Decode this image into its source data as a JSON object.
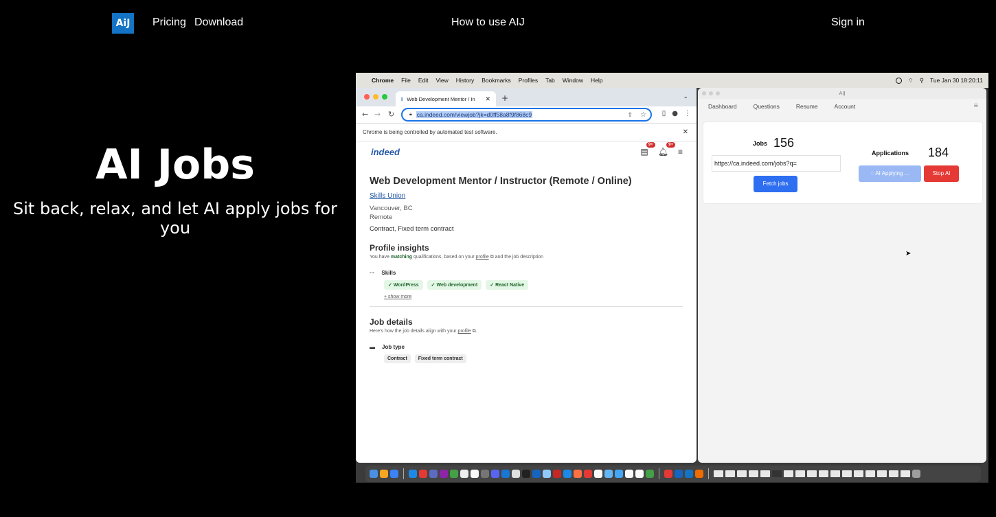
{
  "nav": {
    "logo": "AiJ",
    "pricing": "Pricing",
    "download": "Download",
    "how_to": "How to use AIJ",
    "sign_in": "Sign in"
  },
  "hero": {
    "title": "AI Jobs",
    "subtitle": "Sit back, relax, and let AI apply jobs for you"
  },
  "screenshot": {
    "mac_menu": {
      "app": "Chrome",
      "items": [
        "File",
        "Edit",
        "View",
        "History",
        "Bookmarks",
        "Profiles",
        "Tab",
        "Window",
        "Help"
      ],
      "clock": "Tue Jan 30  18:20:11"
    },
    "browser": {
      "tab_title": "Web Development Mentor / In",
      "url": "ca.indeed.com/viewjob?jk=d0ff58a8f9f868c9",
      "infobar": "Chrome is being controlled by automated test software.",
      "notification_badge": "9+"
    },
    "indeed": {
      "logo": "indeed",
      "job_title": "Web Development Mentor / Instructor (Remote / Online)",
      "company": "Skills Union",
      "location": "Vancouver, BC",
      "remote": "Remote",
      "contract": "Contract, Fixed term contract",
      "profile_insights_title": "Profile insights",
      "profile_insights_pre": "You have ",
      "profile_insights_match": "matching",
      "profile_insights_mid": " qualifications, based on your ",
      "profile_link": "profile",
      "profile_insights_post": " and the job description",
      "skills_label": "Skills",
      "skills": [
        "WordPress",
        "Web development",
        "React Native"
      ],
      "show_more": "+ show more",
      "job_details_title": "Job details",
      "job_details_pre": "Here's how the job details align with your ",
      "job_details_post": ".",
      "job_type_label": "Job type",
      "job_types": [
        "Contract",
        "Fixed term contract"
      ]
    },
    "aij_app": {
      "window_title": "AIJ",
      "nav": [
        "Dashboard",
        "Questions",
        "Resume",
        "Account"
      ],
      "jobs_label": "Jobs",
      "jobs_count": "156",
      "applications_label": "Applications",
      "applications_count": "184",
      "url_value": "https://ca.indeed.com/jobs?q=",
      "fetch_button": "Fetch jobs",
      "applying_button": "AI Applying ...",
      "stop_button": "Stop AI"
    }
  }
}
